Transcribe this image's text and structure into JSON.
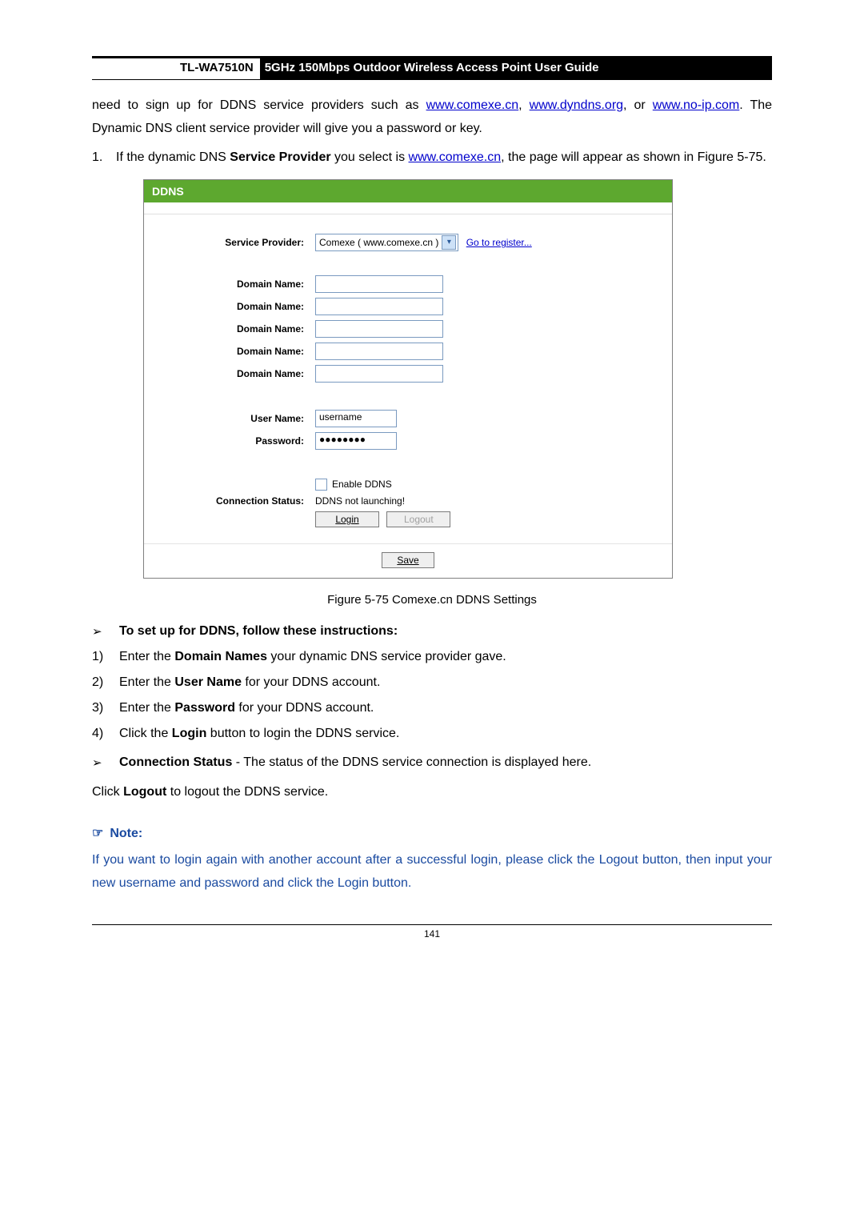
{
  "header": {
    "model": "TL-WA7510N",
    "title": "5GHz 150Mbps Outdoor Wireless Access Point User Guide"
  },
  "intro": {
    "pre": "need to sign up for DDNS service providers such as ",
    "link1": "www.comexe.cn",
    "sep1": ", ",
    "link2": "www.dyndns.org",
    "sep2": ", or ",
    "link3": "www.no-ip.com",
    "post": ". The Dynamic DNS client service provider will give you a password or key."
  },
  "item1": {
    "num": "1.",
    "pre": "If the dynamic DNS ",
    "bold": "Service Provider",
    "mid": " you select is ",
    "link": "www.comexe.cn",
    "post": ", the page will appear as shown in Figure 5-75."
  },
  "ss": {
    "title": "DDNS",
    "labels": {
      "sp": "Service Provider:",
      "dn": "Domain Name:",
      "un": "User Name:",
      "pw": "Password:",
      "cs": "Connection Status:"
    },
    "sp_value": "Comexe ( www.comexe.cn )",
    "register": "Go to register...",
    "username": "username",
    "password": "●●●●●●●●",
    "enable": "Enable DDNS",
    "status_text": "DDNS not launching!",
    "login": "Login",
    "logout": "Logout",
    "save": "Save"
  },
  "figcap": "Figure 5-75 Comexe.cn DDNS Settings",
  "instr_head": {
    "arrow": "➢",
    "text": "To set up for DDNS, follow these instructions:"
  },
  "steps": [
    {
      "n": "1)",
      "pre": "Enter the ",
      "b": "Domain Names",
      "post": " your dynamic DNS service provider gave."
    },
    {
      "n": "2)",
      "pre": "Enter the ",
      "b": "User Name",
      "post": " for your DDNS account."
    },
    {
      "n": "3)",
      "pre": "Enter the ",
      "b": "Password",
      "post": " for your DDNS account."
    },
    {
      "n": "4)",
      "pre": "Click the ",
      "b": "Login",
      "post": " button to login the DDNS service."
    }
  ],
  "conn": {
    "arrow": "➢",
    "b": "Connection Status",
    "post": " - The status of the DDNS service connection is displayed here."
  },
  "logout_line": {
    "pre": "Click ",
    "b": "Logout",
    "post": " to logout the DDNS service."
  },
  "note": {
    "hand": "☞",
    "head": "Note:",
    "body": " If you want to login again with another account after a successful login, please click the Logout button, then input your new username and password and click the Login button."
  },
  "page_num": "141"
}
